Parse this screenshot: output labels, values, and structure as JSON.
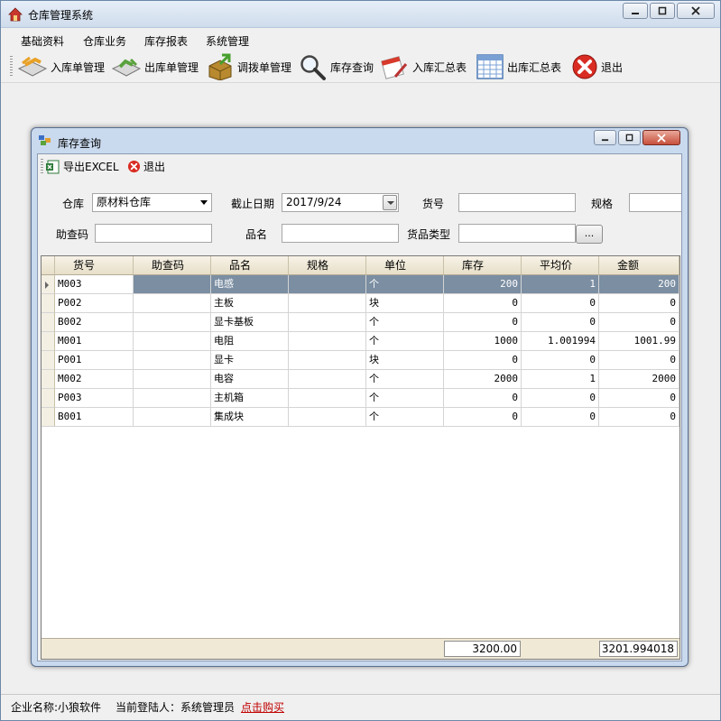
{
  "window": {
    "title": "仓库管理系统"
  },
  "menu": [
    "基础资料",
    "仓库业务",
    "库存报表",
    "系统管理"
  ],
  "toolbar": {
    "inbound": "入库单管理",
    "outbound": "出库单管理",
    "transfer": "调拨单管理",
    "stock_query": "库存查询",
    "inbound_summary": "入库汇总表",
    "outbound_summary": "出库汇总表",
    "exit": "退出"
  },
  "child": {
    "title": "库存查询",
    "export_label": "导出EXCEL",
    "exit_label": "退出",
    "filters": {
      "warehouse_label": "仓库",
      "warehouse_value": "原材料仓库",
      "date_label": "截止日期",
      "date_value": "2017/9/24",
      "sku_label": "货号",
      "sku_value": "",
      "spec_label": "规格",
      "spec_value": "",
      "helper_label": "助查码",
      "helper_value": "",
      "name_label": "品名",
      "name_value": "",
      "category_label": "货品类型",
      "category_value": "",
      "dots_label": "..."
    },
    "grid": {
      "columns": [
        "货号",
        "助查码",
        "品名",
        "规格",
        "单位",
        "库存",
        "平均价",
        "金额"
      ],
      "rows": [
        [
          "M003",
          "",
          "电感",
          "",
          "个",
          "200",
          "1",
          "200"
        ],
        [
          "P002",
          "",
          "主板",
          "",
          "块",
          "0",
          "0",
          "0"
        ],
        [
          "B002",
          "",
          "显卡基板",
          "",
          "个",
          "0",
          "0",
          "0"
        ],
        [
          "M001",
          "",
          "电阻",
          "",
          "个",
          "1000",
          "1.001994",
          "1001.99"
        ],
        [
          "P001",
          "",
          "显卡",
          "",
          "块",
          "0",
          "0",
          "0"
        ],
        [
          "M002",
          "",
          "电容",
          "",
          "个",
          "2000",
          "1",
          "2000"
        ],
        [
          "P003",
          "",
          "主机箱",
          "",
          "个",
          "0",
          "0",
          "0"
        ],
        [
          "B001",
          "",
          "集成块",
          "",
          "个",
          "0",
          "0",
          "0"
        ]
      ],
      "selected_row": 0,
      "totals": {
        "stock": "3200.00",
        "amount": "3201.994018"
      }
    }
  },
  "status": {
    "company": "企业名称:小狼软件",
    "user": "当前登陆人：系统管理员",
    "buy_link": "点击购买"
  }
}
